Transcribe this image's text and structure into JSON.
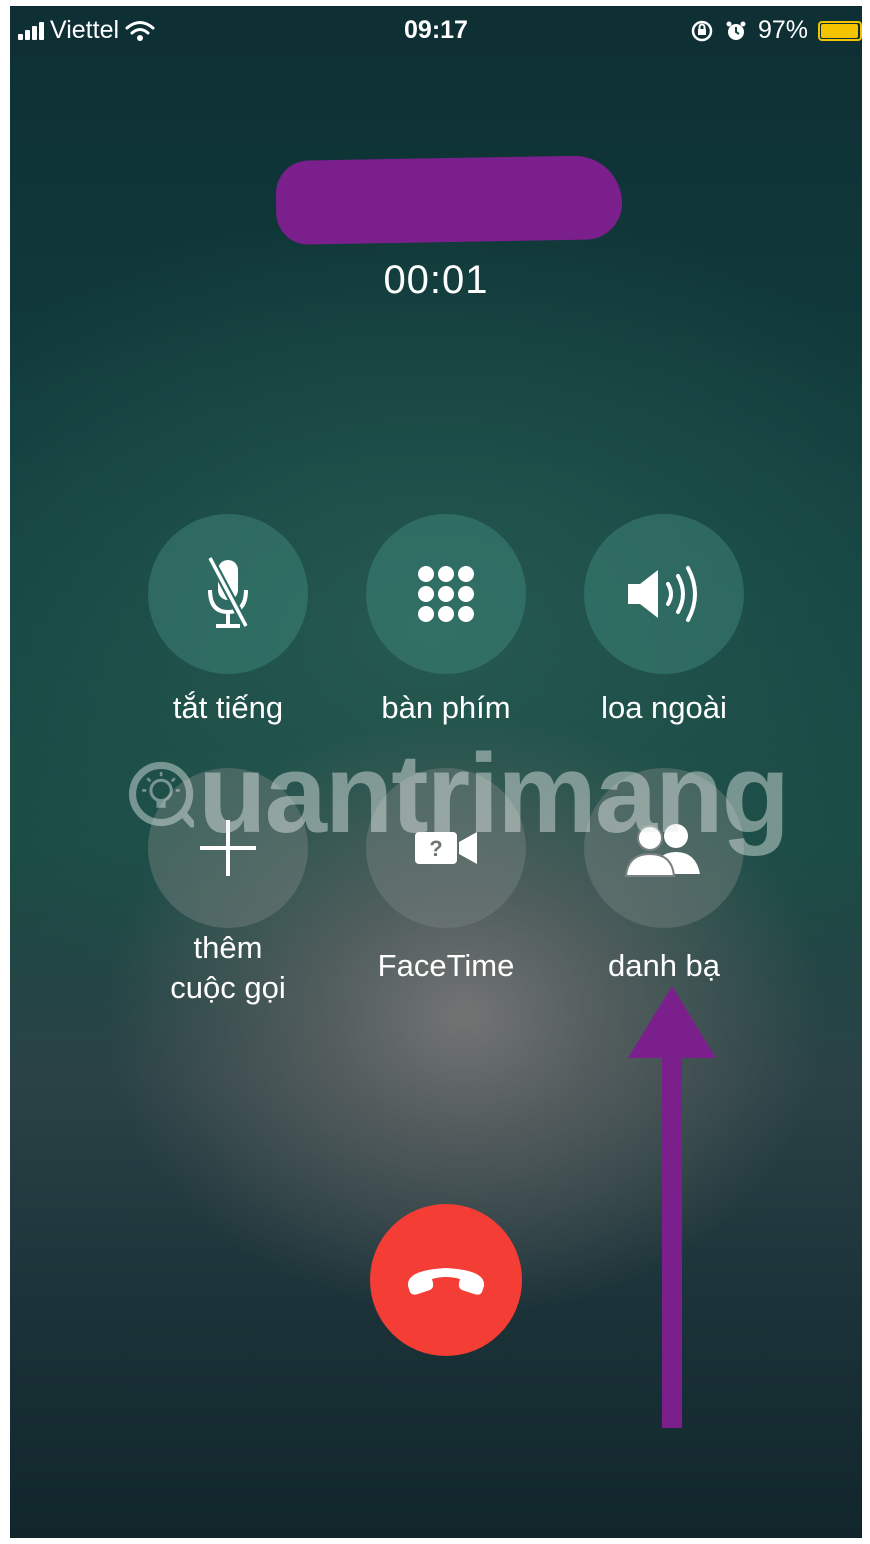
{
  "status_bar": {
    "carrier": "Viettel",
    "time": "09:17",
    "battery_percent": "97%",
    "battery_level": 0.97,
    "icons": [
      "signal-icon",
      "wifi-icon",
      "rotation-lock-icon",
      "alarm-icon",
      "battery-icon"
    ]
  },
  "call": {
    "timer": "00:01"
  },
  "controls": {
    "mute_label": "tắt tiếng",
    "keypad_label": "bàn phím",
    "speaker_label": "loa ngoài",
    "add_call_label_line1": "thêm",
    "add_call_label_line2": "cuộc gọi",
    "facetime_label": "FaceTime",
    "contacts_label": "danh bạ"
  },
  "watermark": {
    "text": "uantrimang"
  },
  "colors": {
    "end_call": "#f43d35",
    "annotation": "#7b1f8d",
    "battery": "#f4c400"
  }
}
